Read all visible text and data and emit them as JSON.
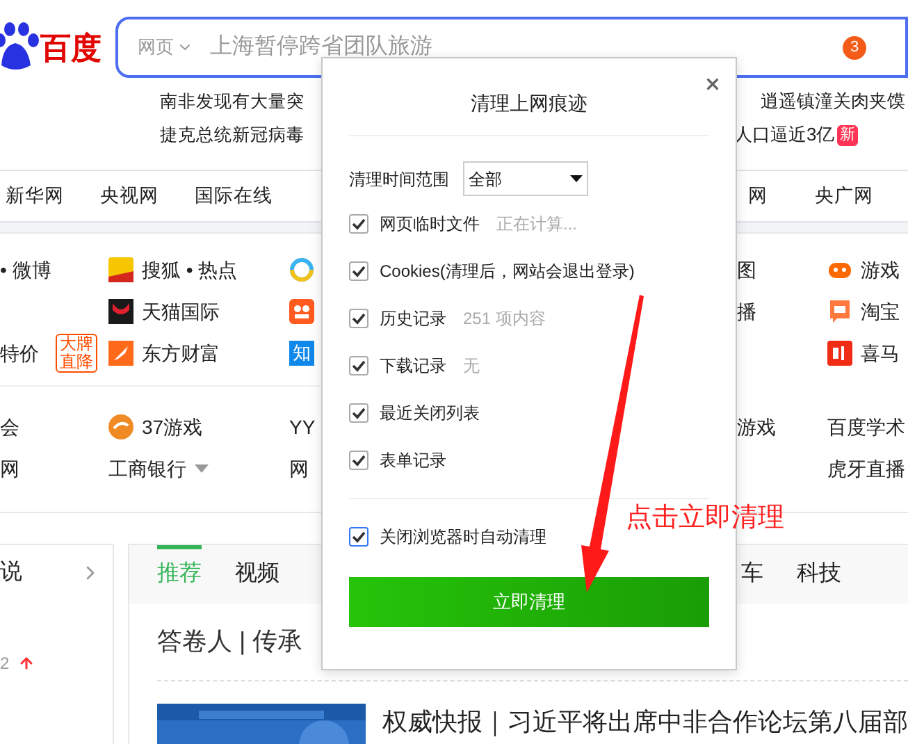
{
  "logo": {
    "text": "百度"
  },
  "search": {
    "scope": "网页",
    "query": "上海暂停跨省团队旅游",
    "badge": "3"
  },
  "hot_news": {
    "left": [
      "南非发现有大量突",
      "捷克总统新冠病毒"
    ],
    "right": [
      {
        "text": "逍遥镇潼关肉夹馍"
      },
      {
        "text": "人口逼近3亿",
        "tag": "新"
      }
    ]
  },
  "nav_links": {
    "left": [
      "新华网",
      "央视网",
      "国际在线"
    ],
    "right": [
      "网",
      "央广网"
    ]
  },
  "site_rows": [
    {
      "cells": [
        {
          "kind": "link",
          "text": "• 微博"
        },
        {
          "kind": "link",
          "text": "搜狐 • 热点"
        },
        {
          "kind": "icon"
        },
        {
          "kind": "link",
          "text": "图"
        },
        {
          "kind": "link",
          "text": "游戏"
        }
      ]
    },
    {
      "cells": [
        {
          "kind": "empty"
        },
        {
          "kind": "link",
          "text": "天猫国际"
        },
        {
          "kind": "icon"
        },
        {
          "kind": "link",
          "text": "播"
        },
        {
          "kind": "link",
          "text": "淘宝"
        }
      ]
    },
    {
      "cells": [
        {
          "kind": "link",
          "text": "特价",
          "badge": "大牌直降"
        },
        {
          "kind": "link",
          "text": "东方财富"
        },
        {
          "kind": "tile",
          "text": "知"
        },
        {
          "kind": "empty"
        },
        {
          "kind": "link",
          "text": "喜马"
        }
      ]
    },
    {
      "cells": [
        {
          "kind": "link",
          "text": "会"
        },
        {
          "kind": "link",
          "text": "37游戏"
        },
        {
          "kind": "link",
          "text": "YY"
        },
        {
          "kind": "link",
          "text": "游戏"
        },
        {
          "kind": "link",
          "text": "百度学术"
        }
      ]
    },
    {
      "cells": [
        {
          "kind": "link",
          "text": "网"
        },
        {
          "kind": "link",
          "text": "工商银行",
          "dropdown": true
        },
        {
          "kind": "link",
          "text": "网"
        },
        {
          "kind": "empty"
        },
        {
          "kind": "link",
          "text": "虎牙直播"
        }
      ]
    }
  ],
  "sidebar": {
    "title": "说",
    "stat": "2"
  },
  "feed": {
    "tabs": [
      {
        "label": "推荐",
        "selected": true
      },
      {
        "label": "视频",
        "selected": false
      }
    ],
    "tabs_right": [
      {
        "label": "车",
        "selected": false
      },
      {
        "label": "科技",
        "selected": false
      }
    ],
    "headline": "答卷人 | 传承",
    "news": [
      {
        "title": "权威快报｜习近平将出席中非合作论坛第八届部",
        "kind": "picture"
      }
    ]
  },
  "dialog": {
    "title": "清理上网痕迹",
    "range_label": "清理时间范围",
    "range_value": "全部",
    "options": [
      {
        "label": "网页临时文件",
        "note": "正在计算...",
        "checked": true
      },
      {
        "label": "Cookies(清理后，网站会退出登录)",
        "checked": true
      },
      {
        "label": "历史记录",
        "note": "251 项内容",
        "checked": true
      },
      {
        "label": "下载记录",
        "note": "无",
        "checked": true
      },
      {
        "label": "最近关闭列表",
        "checked": true
      },
      {
        "label": "表单记录",
        "checked": true
      }
    ],
    "auto_clear": {
      "label": "关闭浏览器时自动清理",
      "checked": true
    },
    "button": "立即清理"
  },
  "annotation": {
    "text": "点击立即清理"
  }
}
